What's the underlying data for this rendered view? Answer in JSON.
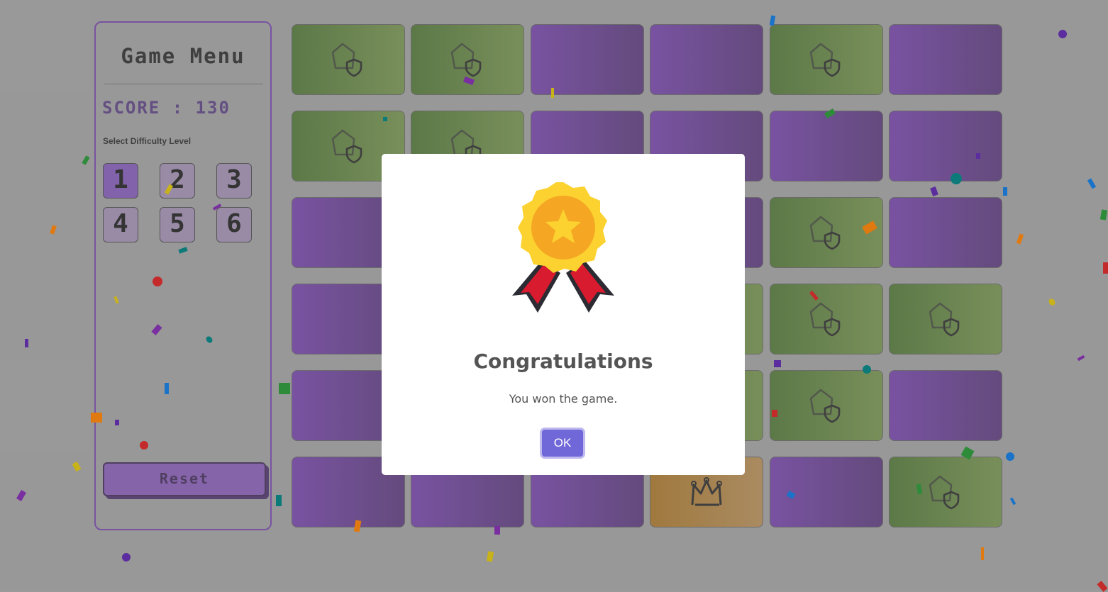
{
  "menu": {
    "title": "Game Menu",
    "score_text": "SCORE : 130",
    "difficulty_label": "Select Difficulty Level",
    "levels": [
      "1",
      "2",
      "3",
      "4",
      "5",
      "6"
    ],
    "active_level": "1",
    "reset_label": "Reset"
  },
  "board": {
    "rows": [
      [
        "green-shield",
        "green-shield",
        "purple",
        "purple",
        "green-shield",
        "purple"
      ],
      [
        "green-shield",
        "green-shield",
        "purple",
        "purple",
        "purple",
        "purple"
      ],
      [
        "purple",
        "purple",
        "purple",
        "purple",
        "green-shield",
        "purple"
      ],
      [
        "purple",
        "purple",
        "purple",
        "green",
        "green-shield",
        "green-shield"
      ],
      [
        "purple",
        "purple",
        "purple",
        "green",
        "green-shield",
        "purple"
      ],
      [
        "purple",
        "purple",
        "purple",
        "gold-crown",
        "purple",
        "green-shield"
      ]
    ],
    "colors": {
      "purple": "#6a2fa8",
      "green": "#3d6a1e",
      "gold": "#a66a10"
    }
  },
  "modal": {
    "icon": "medal-award-icon",
    "title": "Congratulations",
    "text": "You won the game.",
    "ok_label": "OK",
    "ok_color": "#7067d9"
  }
}
